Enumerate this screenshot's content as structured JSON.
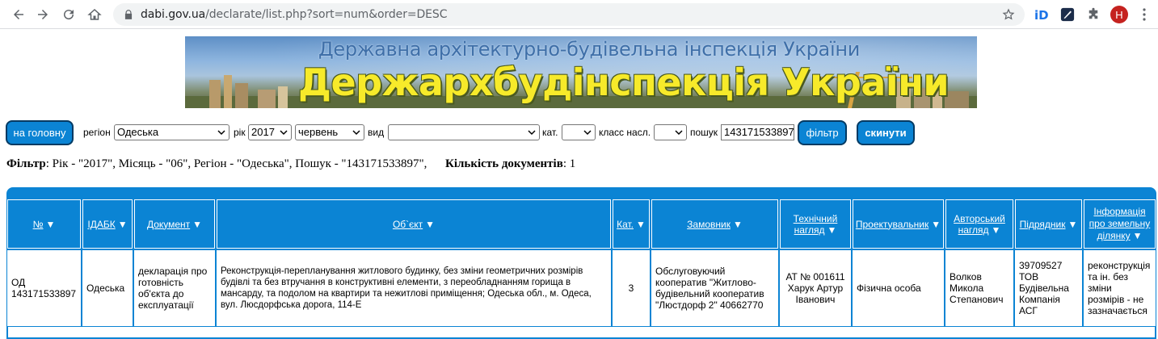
{
  "browser": {
    "url_host": "dabi.gov.ua",
    "url_path": "/declarate/list.php?sort=num&order=DESC",
    "profile_initial": "H"
  },
  "banner": {
    "subtitle": "Державна архітектурно-будівельна інспекція України",
    "title": "Держархбудінспекція України"
  },
  "filters": {
    "home_label": "на головну",
    "region_label": "регіон",
    "region_value": "Одеська",
    "year_label": "рік",
    "year_value": "2017",
    "month_value": "червень",
    "type_label": "вид",
    "type_value": "",
    "cat_label": "кат.",
    "cat_value": "",
    "class_label": "класс насл.",
    "class_value": "",
    "search_label": "пошук",
    "search_value": "143171533897",
    "filter_button": "фільтр",
    "reset_button": "скинути"
  },
  "summary": {
    "filter_label": "Фільтр",
    "filter_text": ": Рік - \"2017\", Місяць - \"06\", Регіон - \"Одеська\", Пошук - \"143171533897\",",
    "count_label": "Кількість документів",
    "count_text": ": 1"
  },
  "table": {
    "headers": {
      "num": "№",
      "idabk": "ІДАБК",
      "document": "Документ",
      "object": "Об`єкт",
      "cat": "Кат.",
      "customer": "Замовник",
      "tech_1": "Технічний",
      "tech_2": "нагляд",
      "designer": "Проектувальник",
      "author_1": "Авторський",
      "author_2": "нагляд",
      "contractor": "Підрядник",
      "land_1": "Інформація",
      "land_2": "про земельну",
      "land_3": "ділянку",
      "sort_icon": "▼"
    },
    "row": {
      "num_1": "ОД",
      "num_2": "143171533897",
      "idabk": "Одеська",
      "document_1": "декларація про",
      "document_2": "готовність",
      "document_3": "об'єкта до",
      "document_4": "експлуатації",
      "object_1": "Реконструкція-перепланування житлового будинку, без зміни геометричних розмірів",
      "object_2": "будівлі та без втручання в конструктивні елементи, з переобладнанням горища в",
      "object_3": "мансарду, та подолом на квартири та нежитлові приміщення; Одеська обл., м. Одеса,",
      "object_4": "вул. Люсдорфська дорога, 114-Е",
      "cat": "3",
      "customer_1": "Обслуговуючий",
      "customer_2": "кооператив \"Житлово-",
      "customer_3": "будівельний кооператив",
      "customer_4": "\"Люстдорф 2\" 40662770",
      "tech_1": "АТ № 001611",
      "tech_2": "Харук Артур",
      "tech_3": "Іванович",
      "designer": "Фізична особа",
      "author_1": "Волков",
      "author_2": "Микола",
      "author_3": "Степанович",
      "contractor_1": "39709527",
      "contractor_2": "ТОВ",
      "contractor_3": "Будівельна",
      "contractor_4": "Компанія",
      "contractor_5": "АСГ",
      "land_1": "реконструкція",
      "land_2": "та ін. без",
      "land_3": "зміни",
      "land_4": "розмірів - не",
      "land_5": "зазначається"
    }
  }
}
